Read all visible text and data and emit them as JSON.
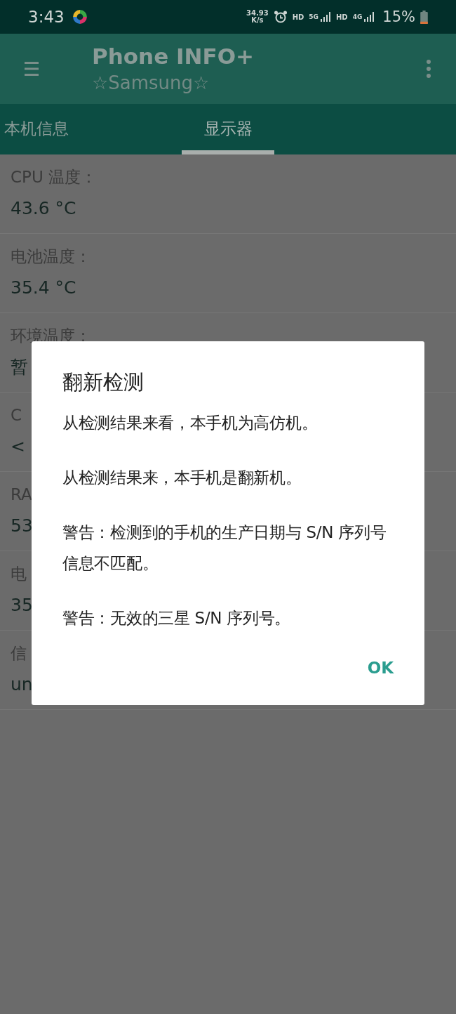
{
  "status_bar": {
    "time": "3:43",
    "speed_value": "34.93",
    "speed_unit": "K/s",
    "hd_1": "HD",
    "network_1": "5G",
    "hd_2": "HD",
    "network_2": "4G",
    "battery": "15%"
  },
  "app_bar": {
    "title": "Phone INFO+",
    "subtitle": "☆Samsung☆"
  },
  "tabs": [
    {
      "label": "本机信息",
      "selected": false
    },
    {
      "label": "显示器",
      "selected": true
    }
  ],
  "items": [
    {
      "label": "CPU 温度：",
      "value": "43.6 °C"
    },
    {
      "label": "电池温度：",
      "value": "35.4 °C"
    },
    {
      "label": "环境温度：",
      "value": "暂"
    },
    {
      "label": "C",
      "value": "<"
    },
    {
      "label": "RA",
      "value": "53"
    },
    {
      "label": "电",
      "value": "35"
    },
    {
      "label": "信",
      "value": "un"
    }
  ],
  "dialog": {
    "title": "翻新检测",
    "messages": [
      "从检测结果来看，本手机为高仿机。",
      "从检测结果来，本手机是翻新机。",
      "警告：检测到的手机的生产日期与 S/N 序列号信息不匹配。",
      "警告：无效的三星 S/N 序列号。"
    ],
    "button": "OK"
  }
}
